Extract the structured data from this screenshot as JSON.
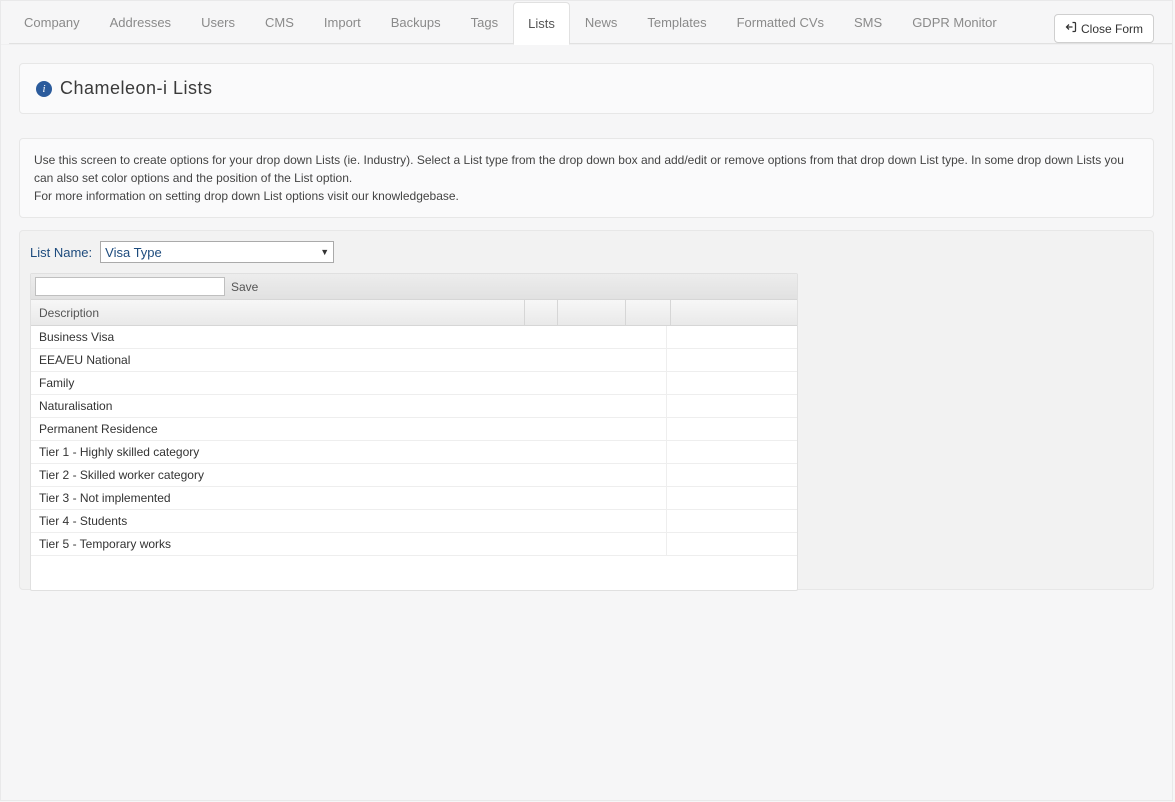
{
  "tabs": [
    {
      "label": "Company"
    },
    {
      "label": "Addresses"
    },
    {
      "label": "Users"
    },
    {
      "label": "CMS"
    },
    {
      "label": "Import"
    },
    {
      "label": "Backups"
    },
    {
      "label": "Tags"
    },
    {
      "label": "Lists"
    },
    {
      "label": "News"
    },
    {
      "label": "Templates"
    },
    {
      "label": "Formatted CVs"
    },
    {
      "label": "SMS"
    },
    {
      "label": "GDPR Monitor"
    }
  ],
  "active_tab_index": 7,
  "close_form_label": "Close Form",
  "page_title": "Chameleon-i Lists",
  "intro_line1": "Use this screen to create options for your drop down Lists (ie. Industry). Select a List type from the drop down box and add/edit or remove options from that drop down List type. In some drop down Lists you can also set color options and the position of the List option.",
  "intro_line2": "For more information on setting drop down List options visit our knowledgebase.",
  "list_name_label": "List Name:",
  "list_name_value": "Visa Type",
  "toolbar": {
    "input_value": "",
    "save_label": "Save"
  },
  "column_header": {
    "description": "Description"
  },
  "rows": [
    {
      "description": "Business Visa"
    },
    {
      "description": "EEA/EU National"
    },
    {
      "description": "Family"
    },
    {
      "description": "Naturalisation"
    },
    {
      "description": "Permanent Residence"
    },
    {
      "description": "Tier 1 - Highly skilled category"
    },
    {
      "description": "Tier 2 - Skilled worker category"
    },
    {
      "description": "Tier 3 - Not implemented"
    },
    {
      "description": "Tier 4 - Students"
    },
    {
      "description": "Tier 5 - Temporary works"
    }
  ]
}
